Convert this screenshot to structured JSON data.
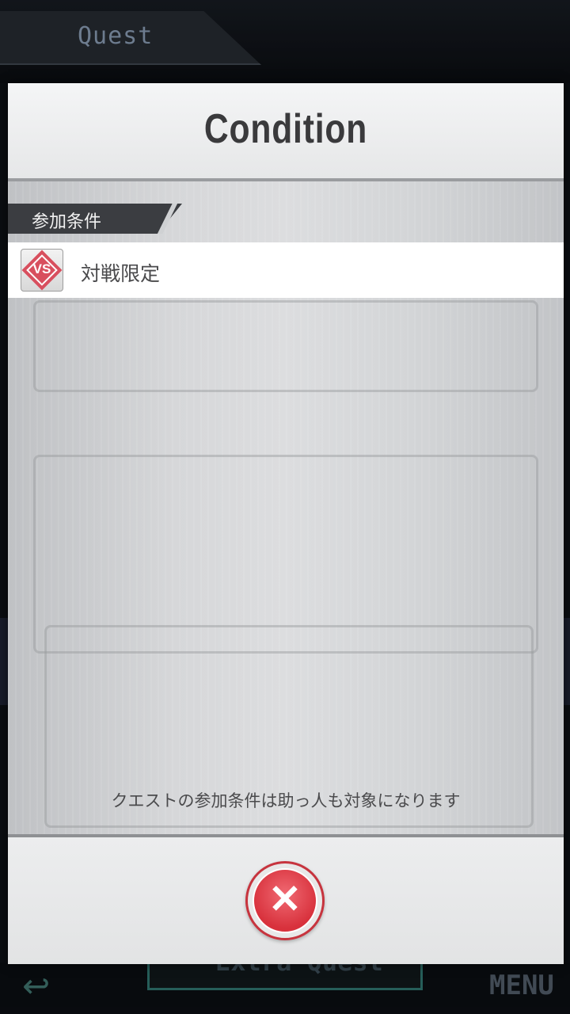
{
  "background": {
    "title": "Quest",
    "extra_button": "Extra Quest",
    "menu": "MENU"
  },
  "modal": {
    "title": "Condition",
    "section_label": "参加条件",
    "conditions": [
      {
        "icon": "vs-icon",
        "badge_text": "VS",
        "label": "対戦限定"
      }
    ],
    "note": "クエストの参加条件は助っ人も対象になります",
    "close_glyph": "✕"
  },
  "colors": {
    "accent_red": "#d8313c",
    "header_dark": "#3b3d41"
  }
}
